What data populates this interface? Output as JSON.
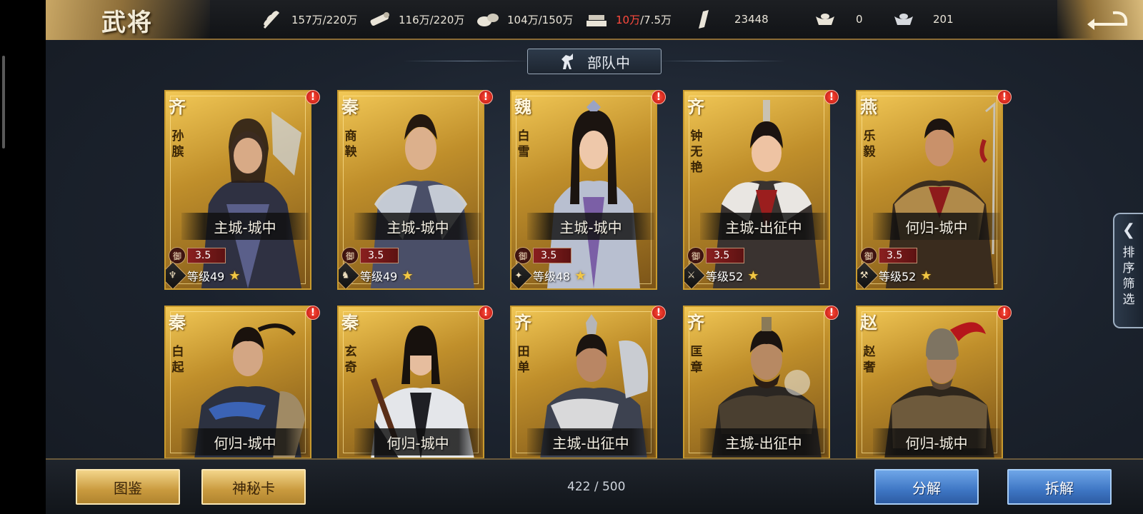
{
  "header": {
    "title": "武将",
    "resources": [
      {
        "icon": "wheat-icon",
        "value": "157万/220万"
      },
      {
        "icon": "wood-icon",
        "value": "116万/220万"
      },
      {
        "icon": "stone-icon",
        "value": "104万/150万"
      },
      {
        "icon": "iron-icon",
        "value_over": "10万",
        "value_rest": "/7.5万"
      },
      {
        "icon": "command-token-icon",
        "value": "23448"
      },
      {
        "icon": "gold-ingot-icon",
        "value": "0"
      },
      {
        "icon": "silver-ingot-icon",
        "value": "201"
      }
    ]
  },
  "section": {
    "label": "部队中"
  },
  "cards": [
    {
      "faction": "齐",
      "name": "孙膑",
      "status": "主城-城中",
      "defense_label": "御",
      "defense": "3.5",
      "level": "等级49",
      "alert": "!"
    },
    {
      "faction": "秦",
      "name": "商鞅",
      "status": "主城-城中",
      "defense_label": "御",
      "defense": "3.5",
      "level": "等级49",
      "alert": "!"
    },
    {
      "faction": "魏",
      "name": "白雪",
      "status": "主城-城中",
      "defense_label": "御",
      "defense": "3.5",
      "level": "等级48",
      "alert": "!"
    },
    {
      "faction": "齐",
      "name": "钟无艳",
      "status": "主城-出征中",
      "defense_label": "御",
      "defense": "3.5",
      "level": "等级52",
      "alert": "!"
    },
    {
      "faction": "燕",
      "name": "乐毅",
      "status": "何归-城中",
      "defense_label": "御",
      "defense": "3.5",
      "level": "等级52",
      "alert": "!"
    },
    {
      "faction": "秦",
      "name": "白起",
      "status": "何归-城中",
      "alert": "!"
    },
    {
      "faction": "秦",
      "name": "玄奇",
      "status": "何归-城中",
      "alert": "!"
    },
    {
      "faction": "齐",
      "name": "田单",
      "status": "主城-出征中",
      "alert": "!"
    },
    {
      "faction": "齐",
      "name": "匡章",
      "status": "主城-出征中",
      "alert": "!"
    },
    {
      "faction": "赵",
      "name": "赵奢",
      "status": "何归-城中",
      "alert": "!"
    }
  ],
  "side_tab": {
    "label": "排序筛选"
  },
  "footer": {
    "atlas_button": "图鉴",
    "mystery_card_button": "神秘卡",
    "count": "422 / 500",
    "decompose_button": "分解",
    "dismantle_button": "拆解"
  },
  "colors": {
    "gold": "#c89a2e",
    "warning": "#ff4a3d",
    "blue_button": "#3e76c4"
  }
}
